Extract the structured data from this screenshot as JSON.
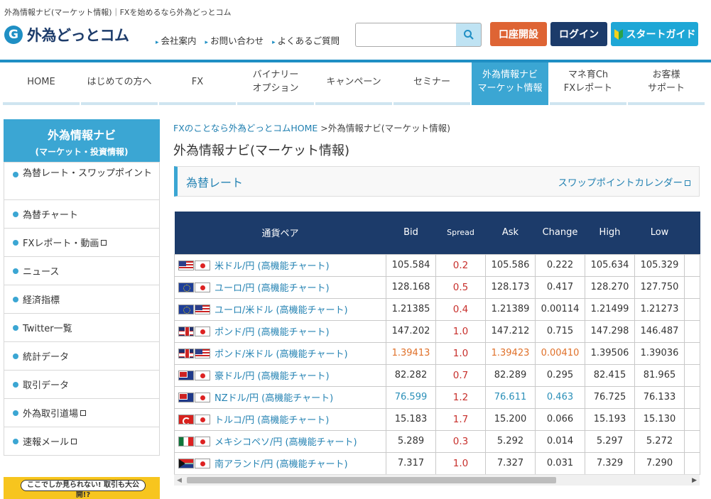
{
  "header": {
    "tagline": "外為情報ナビ(マーケット情報)｜FXを始めるなら外為どっとコム",
    "logo_mark": "G",
    "logo_text": "外為どっとコム",
    "links": [
      "会社案内",
      "お問い合わせ",
      "よくあるご質問"
    ],
    "search": {
      "value": "",
      "placeholder": ""
    },
    "buttons": {
      "open_account": "口座開設",
      "login": "ログイン",
      "start_guide": "スタートガイド"
    }
  },
  "global_nav": [
    {
      "label": "HOME"
    },
    {
      "label": "はじめての方へ"
    },
    {
      "label": "FX"
    },
    {
      "label": "バイナリー\nオプション"
    },
    {
      "label": "キャンペーン"
    },
    {
      "label": "セミナー"
    },
    {
      "label": "外為情報ナビ\nマーケット情報"
    },
    {
      "label": "マネ育Ch\nFXレポート"
    },
    {
      "label": "お客様\nサポート"
    }
  ],
  "sidebar": {
    "title": "外為情報ナビ",
    "subtitle": "(マーケット・投資情報)",
    "items": [
      {
        "label": "為替レート・スワップポイント"
      },
      {
        "label": "為替チャート"
      },
      {
        "label": "FXレポート・動画"
      },
      {
        "label": "ニュース"
      },
      {
        "label": "経済指標"
      },
      {
        "label": "Twitter一覧"
      },
      {
        "label": "統計データ"
      },
      {
        "label": "取引データ"
      },
      {
        "label": "外為取引道場"
      },
      {
        "label": "速報メール"
      }
    ],
    "banner_text": "ここでしか見られない! 取引も大公開!?"
  },
  "main": {
    "breadcrumb_home": "FXのことなら外為どっとコムHOME",
    "breadcrumb_current": " >外為情報ナビ(マーケット情報)",
    "page_title": "外為情報ナビ(マーケット情報)",
    "section_title": "為替レート",
    "section_link": "スワップポイントカレンダー"
  },
  "rates": {
    "headers": [
      "通貨ペア",
      "Bid",
      "Spread",
      "Ask",
      "Change",
      "High",
      "Low"
    ],
    "chart_link": "(高機能チャート)",
    "rows": [
      {
        "flags": [
          "us",
          "jp"
        ],
        "pair": "米ドル/円",
        "bid": "105.584",
        "spread": "0.2",
        "ask": "105.586",
        "change": "0.222",
        "high": "105.634",
        "low": "105.329",
        "tone": ""
      },
      {
        "flags": [
          "eu",
          "jp"
        ],
        "pair": "ユーロ/円",
        "bid": "128.168",
        "spread": "0.5",
        "ask": "128.173",
        "change": "0.417",
        "high": "128.270",
        "low": "127.750",
        "tone": ""
      },
      {
        "flags": [
          "eu",
          "us"
        ],
        "pair": "ユーロ/米ドル",
        "bid": "1.21385",
        "spread": "0.4",
        "ask": "1.21389",
        "change": "0.00114",
        "high": "1.21499",
        "low": "1.21273",
        "tone": ""
      },
      {
        "flags": [
          "gb",
          "jp"
        ],
        "pair": "ポンド/円",
        "bid": "147.202",
        "spread": "1.0",
        "ask": "147.212",
        "change": "0.715",
        "high": "147.298",
        "low": "146.487",
        "tone": ""
      },
      {
        "flags": [
          "gb",
          "us"
        ],
        "pair": "ポンド/米ドル",
        "bid": "1.39413",
        "spread": "1.0",
        "ask": "1.39423",
        "change": "0.00410",
        "high": "1.39506",
        "low": "1.39036",
        "tone": "orange"
      },
      {
        "flags": [
          "au",
          "jp"
        ],
        "pair": "豪ドル/円",
        "bid": "82.282",
        "spread": "0.7",
        "ask": "82.289",
        "change": "0.295",
        "high": "82.415",
        "low": "81.965",
        "tone": ""
      },
      {
        "flags": [
          "nz",
          "jp"
        ],
        "pair": "NZドル/円",
        "bid": "76.599",
        "spread": "1.2",
        "ask": "76.611",
        "change": "0.463",
        "high": "76.725",
        "low": "76.133",
        "tone": "teal"
      },
      {
        "flags": [
          "tr",
          "jp"
        ],
        "pair": "トルコ/円",
        "bid": "15.183",
        "spread": "1.7",
        "ask": "15.200",
        "change": "0.066",
        "high": "15.193",
        "low": "15.130",
        "tone": ""
      },
      {
        "flags": [
          "mx",
          "jp"
        ],
        "pair": "メキシコペソ/円",
        "bid": "5.289",
        "spread": "0.3",
        "ask": "5.292",
        "change": "0.014",
        "high": "5.297",
        "low": "5.272",
        "tone": ""
      },
      {
        "flags": [
          "za",
          "jp"
        ],
        "pair": "南アランド/円",
        "bid": "7.317",
        "spread": "1.0",
        "ask": "7.327",
        "change": "0.031",
        "high": "7.329",
        "low": "7.290",
        "tone": ""
      }
    ]
  },
  "colors": {
    "accent": "#3ba6d3",
    "navy": "#1c3b6a",
    "orange_button": "#de6434",
    "spread_red": "#c8302c",
    "up_orange": "#e0712a",
    "up_teal": "#2a8fb8"
  }
}
